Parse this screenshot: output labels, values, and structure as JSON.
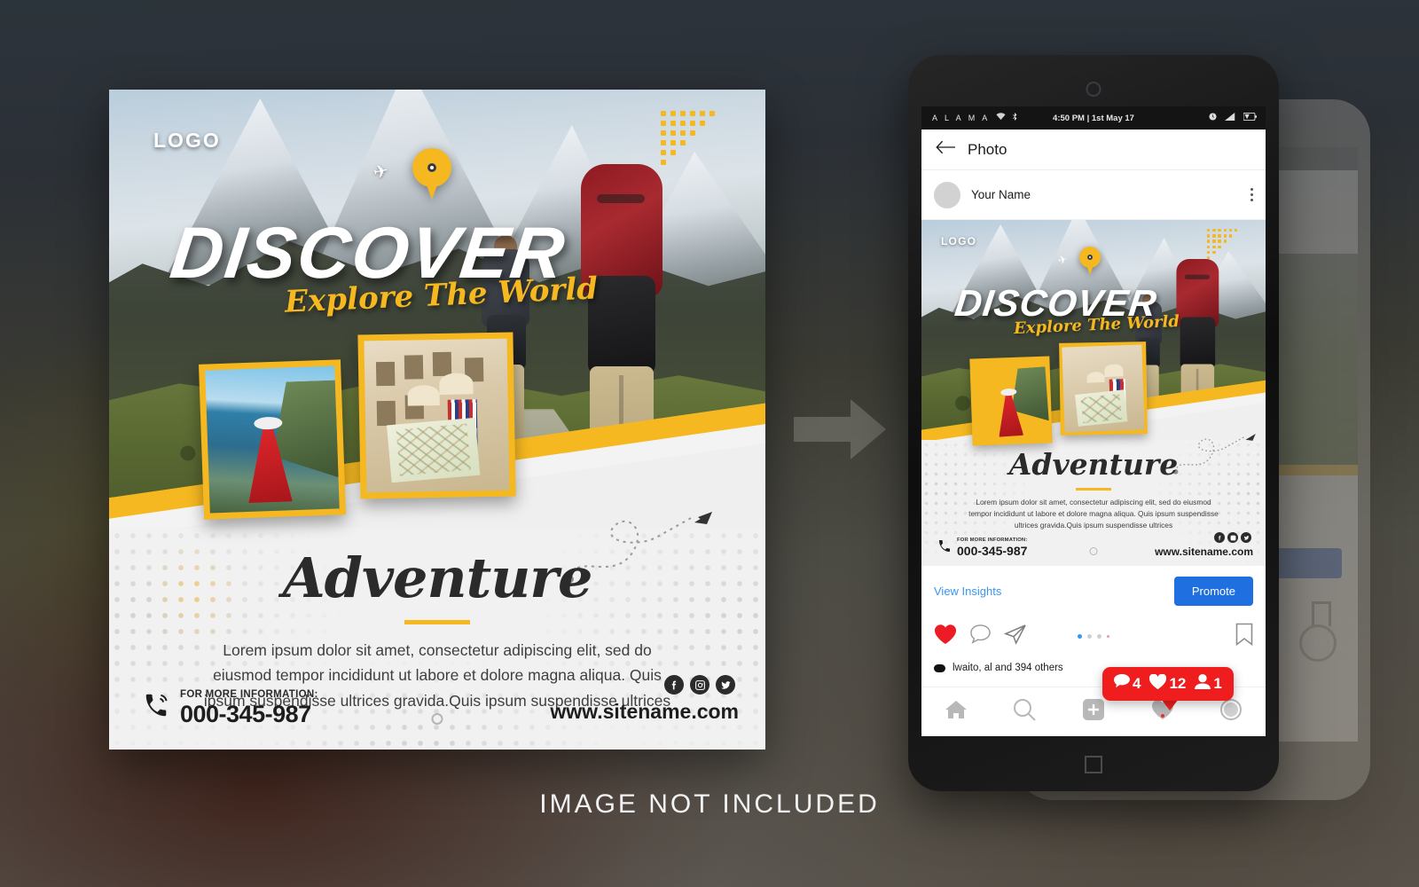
{
  "caption": "IMAGE NOT INCLUDED",
  "poster": {
    "logo": "LOGO",
    "headline": "DISCOVER",
    "tagline": "Explore The World",
    "section_title": "Adventure",
    "body_text": "Lorem ipsum dolor sit amet, consectetur adipiscing elit, sed do eiusmod tempor incididunt ut labore et dolore magna aliqua. Quis ipsum suspendisse ultrices gravida.Quis ipsum suspendisse ultrices",
    "contact_label": "FOR MORE INFORMATION:",
    "phone": "000-345-987",
    "website": "www.sitename.com",
    "socials": [
      "facebook-icon",
      "instagram-icon",
      "twitter-icon"
    ],
    "accent_color": "#f5b820",
    "icons": {
      "pin": "location-pin-icon",
      "plane": "airplane-icon",
      "phone": "phone-ring-icon"
    }
  },
  "phone": {
    "statusbar": {
      "carrier": "A L A M A",
      "wifi": "wifi-icon",
      "bluetooth": "bluetooth-icon",
      "time": "4:50 PM | 1st May 17",
      "alarm": "alarm-icon",
      "signal": "signal-icon",
      "battery": "battery-icon"
    },
    "header": {
      "back": "back-arrow-icon",
      "title": "Photo"
    },
    "post": {
      "username": "Your Name",
      "menu": "kebab-menu-icon"
    },
    "insights": {
      "view_insights": "View Insights",
      "promote": "Promote",
      "promote_color": "#1f6fe0"
    },
    "actions": {
      "like": "heart-filled-icon",
      "comment": "comment-icon",
      "share": "send-icon",
      "bookmark": "bookmark-icon"
    },
    "likes_text": "lwaito, al  and 394 others",
    "tabbar": [
      "home-icon",
      "search-icon",
      "add-icon",
      "activity-icon",
      "profile-icon"
    ],
    "notification": {
      "comments": "4",
      "likes": "12",
      "followers": "1",
      "color": "#ef1d1d"
    }
  },
  "arrow": {
    "name": "right-arrow-icon"
  }
}
